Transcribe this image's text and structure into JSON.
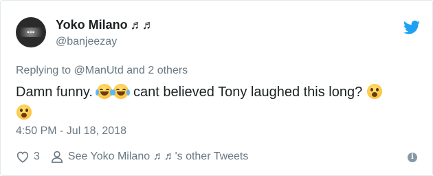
{
  "tweet": {
    "author_name": "Yoko Milano",
    "author_name_notes": "♬♬",
    "handle": "@banjeezay",
    "reply_prefix": "Replying to",
    "reply_mention": "@ManUtd",
    "reply_suffix": "and 2 others",
    "text_part1": "Damn funny.",
    "text_part2": "cant believed Tony laughed this long?",
    "timestamp": "4:50 PM - Jul 18, 2018",
    "like_count": "3",
    "see_other_prefix": "See Yoko Milano",
    "see_other_notes": "♬♬",
    "see_other_suffix": "'s other Tweets"
  },
  "icons": {
    "brand": "twitter-bird-icon",
    "like": "heart-icon",
    "profile": "person-icon",
    "info": "info-icon",
    "emoji_laugh": "tears-of-joy-emoji",
    "emoji_wow": "hushed-face-emoji",
    "emoji_astonished": "astonished-face-emoji"
  },
  "colors": {
    "twitter_blue": "#1da1f2",
    "secondary_text": "#697882",
    "primary_text": "#1c2022"
  }
}
